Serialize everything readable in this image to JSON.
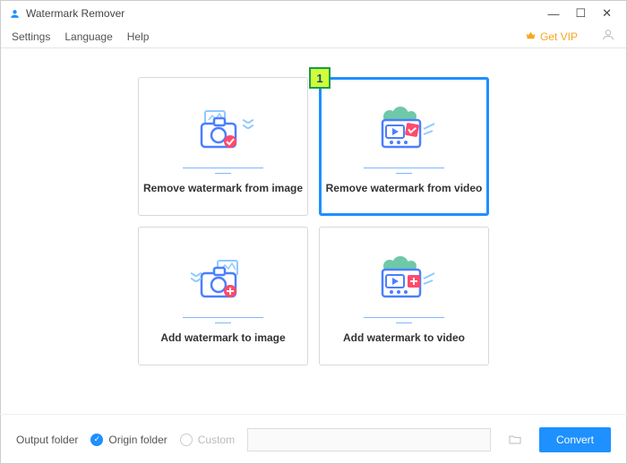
{
  "titlebar": {
    "app_name": "Watermark Remover"
  },
  "menu": {
    "settings": "Settings",
    "language": "Language",
    "help": "Help",
    "getvip": "Get VIP"
  },
  "cards": {
    "remove_image": "Remove watermark from image",
    "remove_video": "Remove watermark from video",
    "add_image": "Add watermark to image",
    "add_video": "Add watermark to video"
  },
  "annotation": {
    "step1": "1"
  },
  "footer": {
    "output_label": "Output folder",
    "origin": "Origin folder",
    "custom": "Custom",
    "convert": "Convert"
  }
}
